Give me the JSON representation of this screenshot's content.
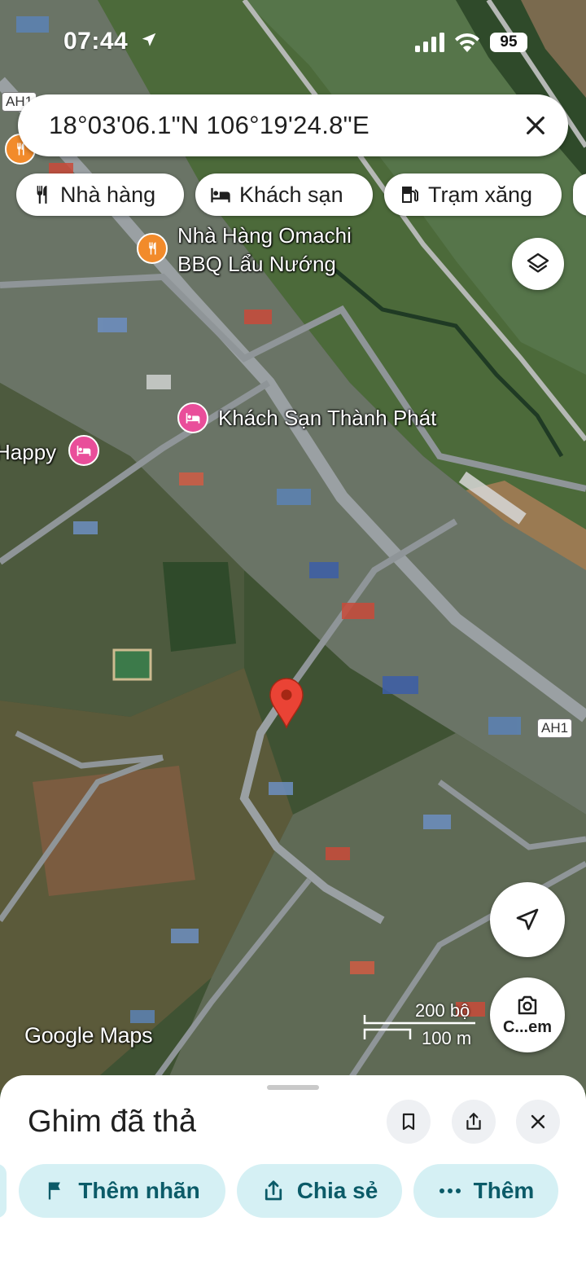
{
  "status_bar": {
    "time": "07:44",
    "battery": "95"
  },
  "search": {
    "coordinates": "18°03'06.1\"N 106°19'24.8\"E"
  },
  "chips": [
    {
      "label": "Nhà hàng",
      "icon": "restaurant-icon"
    },
    {
      "label": "Khách sạn",
      "icon": "hotel-icon"
    },
    {
      "label": "Trạm xăng",
      "icon": "gas-station-icon"
    }
  ],
  "map": {
    "places": [
      {
        "name_line1": "Nhà Hàng Omachi",
        "name_line2": "BBQ Lẩu Nướng",
        "type": "restaurant",
        "color": "#f28b2b"
      },
      {
        "name": "Khách Sạn Thành Phát",
        "type": "hotel",
        "color": "#e94e9a"
      },
      {
        "name": "Happy",
        "type": "hotel",
        "color": "#e94e9a"
      }
    ],
    "road_shields": [
      "AH1",
      "AH1"
    ],
    "logo": "Google Maps",
    "scale": {
      "top_label": "200 bộ",
      "bottom_label": "100 m"
    },
    "camera_button_label": "C...em",
    "pin_color": "#ea4335"
  },
  "sheet": {
    "title": "Ghim đã thả",
    "actions": [
      {
        "label": "Thêm nhãn",
        "icon": "flag-icon"
      },
      {
        "label": "Chia sẻ",
        "icon": "share-icon"
      },
      {
        "label": "Thêm",
        "icon": "more-icon"
      }
    ],
    "accent_color": "#0b5b68",
    "action_bg": "#d5f0f4"
  }
}
